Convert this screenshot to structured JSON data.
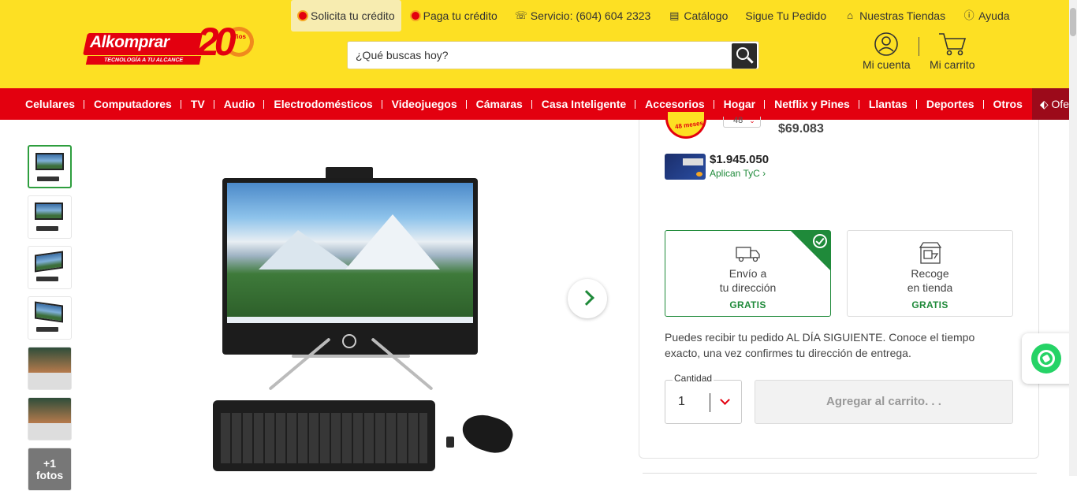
{
  "logo": {
    "brand": "Alkomprar",
    "tagline": "TECNOLOGÍA A TU ALCANCE",
    "anniversary_number": "20",
    "anniversary_word": "Años"
  },
  "toplinks": [
    {
      "label": "Solicita tu crédito",
      "icon": "credit-coin-icon"
    },
    {
      "label": "Paga tu crédito",
      "icon": "pay-coin-icon"
    },
    {
      "label": "Servicio: (604) 604 2323",
      "icon": "headset-icon"
    },
    {
      "label": "Catálogo",
      "icon": "catalog-book-icon"
    },
    {
      "label": "Sigue Tu Pedido",
      "icon": ""
    },
    {
      "label": "Nuestras Tiendas",
      "icon": "store-icon"
    },
    {
      "label": "Ayuda",
      "icon": "info-icon"
    }
  ],
  "search": {
    "placeholder": "¿Qué buscas hoy?"
  },
  "account": {
    "account_label": "Mi cuenta",
    "cart_label": "Mi carrito"
  },
  "nav": [
    "Celulares",
    "Computadores",
    "TV",
    "Audio",
    "Electrodomésticos",
    "Videojuegos",
    "Cámaras",
    "Casa Inteligente",
    "Accesorios",
    "Hogar",
    "Netflix y Pines",
    "Llantas",
    "Deportes",
    "Otros"
  ],
  "nav_offers": "Ofertas",
  "gallery": {
    "more_count": "+1",
    "more_label": "fotos"
  },
  "price_panel": {
    "badge_text": "48 meses",
    "installments_value": "48",
    "installment_price": "$69.083",
    "card_price": "$1.945.050",
    "card_terms": "Aplican TyC"
  },
  "shipping_options": [
    {
      "line1": "Envío a",
      "line2": "tu dirección",
      "price": "GRATIS",
      "selected": true,
      "icon": "truck-icon"
    },
    {
      "line1": "Recoge",
      "line2": "en tienda",
      "price": "GRATIS",
      "selected": false,
      "icon": "store-pickup-icon"
    }
  ],
  "delivery_text": "Puedes recibir tu pedido AL DÍA SIGUIENTE. Conoce el tiempo exacto, una vez confirmes tu dirección de entrega.",
  "quantity": {
    "label": "Cantidad",
    "value": "1"
  },
  "add_to_cart": "Agregar al carrito. . .",
  "colors": {
    "header_yellow": "#fde023",
    "nav_red": "#e3000f",
    "offers_dark_red": "#9c0a1a",
    "accent_green": "#1f8a3a",
    "whatsapp_green": "#25d366"
  }
}
